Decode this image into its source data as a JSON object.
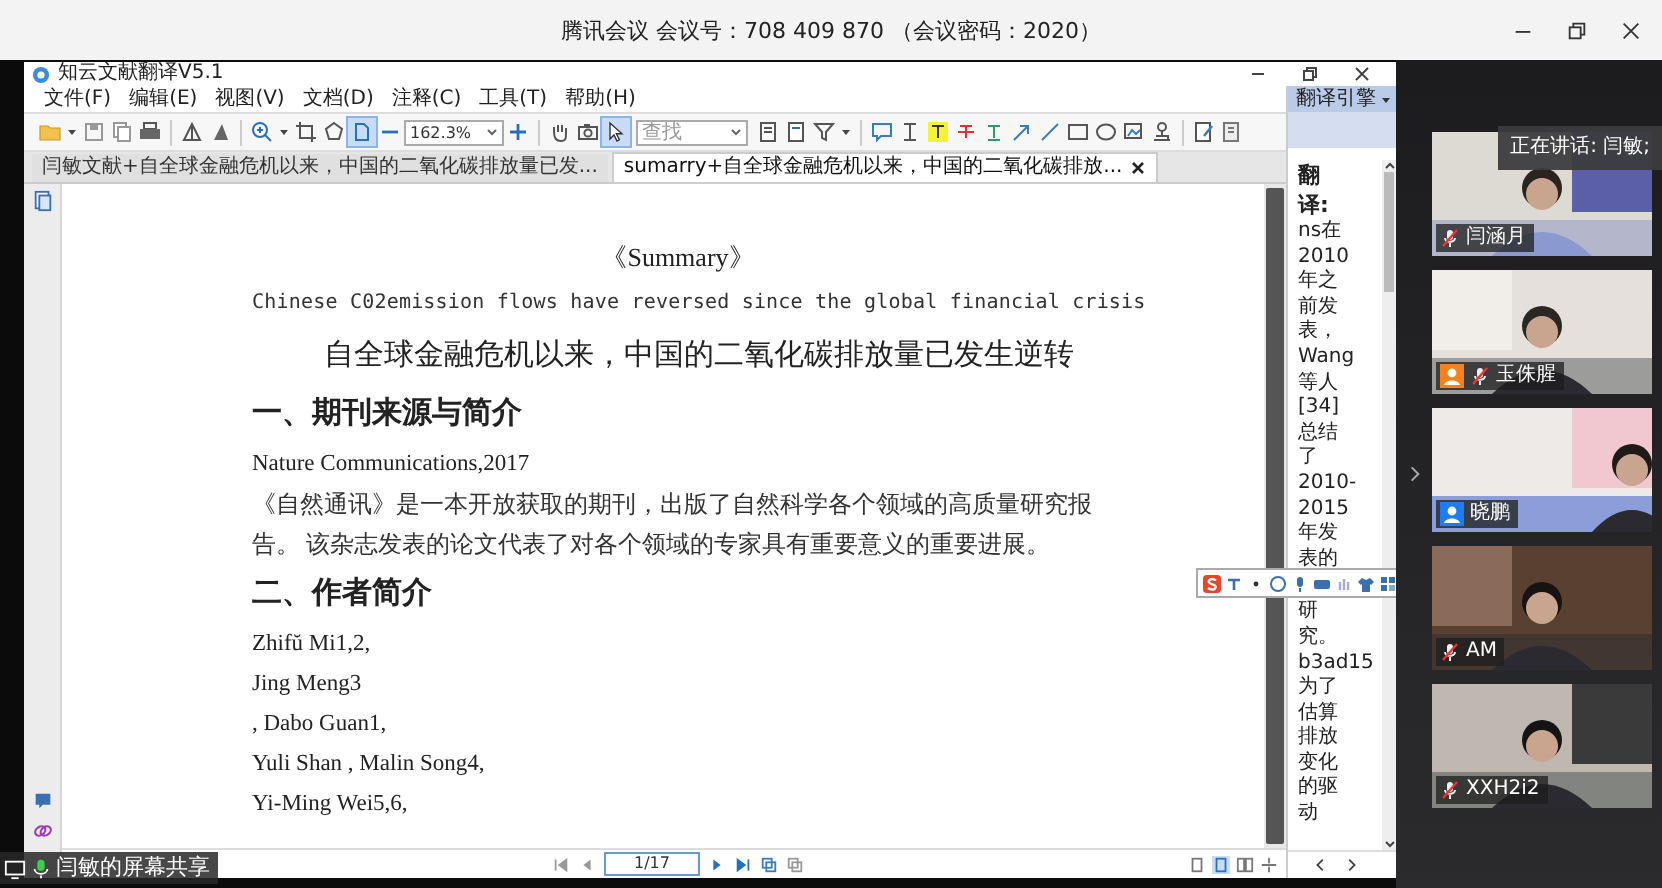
{
  "meeting_bar": {
    "title": "腾讯会议 会议号：708 409 870 （会议密码：2020）"
  },
  "app": {
    "title": "知云文献翻译V5.1",
    "menu": [
      "文件(F)",
      "编辑(E)",
      "视图(V)",
      "文档(D)",
      "注释(C)",
      "工具(T)",
      "帮助(H)"
    ],
    "toolbar": {
      "fit_page_selected": true,
      "select_tool_selected": true,
      "zoom": "162.3%",
      "search": "查找"
    },
    "tabs": [
      {
        "label": "闫敏文献+自全球金融危机以来，中国的二氧化碳排放量已发...",
        "selected": false,
        "closable": false
      },
      {
        "label": "sumarry+自全球金融危机以来，中国的二氧化碳排放...",
        "selected": true,
        "closable": true
      }
    ],
    "document": [
      {
        "kind": "title",
        "text": "《Summary》"
      },
      {
        "kind": "en",
        "text": "Chinese C02emission flows have reversed since the global financial crisis"
      },
      {
        "kind": "zh-title",
        "text": "自全球金融危机以来，中国的二氧化碳排放量已发生逆转"
      },
      {
        "kind": "heading",
        "text": "一、期刊来源与简介"
      },
      {
        "kind": "text",
        "text": "Nature Communications,2017"
      },
      {
        "kind": "para",
        "text": "《自然通讯》是一本开放获取的期刊，出版了自然科学各个领域的高质量研究报告。 该杂志发表的论文代表了对各个领域的专家具有重要意义的重要进展。"
      },
      {
        "kind": "heading",
        "text": "二、作者简介"
      },
      {
        "kind": "text",
        "text": "Zhifŭ Mi1,2,"
      },
      {
        "kind": "text",
        "text": "Jing Meng3"
      },
      {
        "kind": "text",
        "text": ", Dabo Guan1,"
      },
      {
        "kind": "text",
        "text": "Yuli Shan , Malin Song4,"
      },
      {
        "kind": "text",
        "text": "Yi-Ming Wei5,6,"
      }
    ],
    "page_field": "1/17",
    "translation": {
      "engine": "翻译引擎",
      "heading": [
        "翻",
        "译:"
      ],
      "lines_above": [
        "ns在",
        "2010",
        "年之",
        "前发",
        "表，",
        "Wang",
        "等人",
        "[34]",
        "总结",
        "了",
        "2010-",
        "2015",
        "年发",
        "表的"
      ],
      "lines_below": [
        "研",
        "究。",
        "b3ad15",
        "为了",
        "估算",
        "排放",
        "变化",
        "的驱",
        "动"
      ]
    }
  },
  "speaking": "正在讲话: 闫敏;",
  "participants": [
    {
      "name": "闫涵月",
      "muted": true
    },
    {
      "name": "玉侏腥",
      "muted": true,
      "color": "#f5821f"
    },
    {
      "name": "晓鹏",
      "muted": false,
      "color": "#1f7cf2"
    },
    {
      "name": "AM",
      "muted": true
    },
    {
      "name": "XXH2i2",
      "muted": true
    }
  ],
  "share_label": "闫敏的屏幕共享"
}
